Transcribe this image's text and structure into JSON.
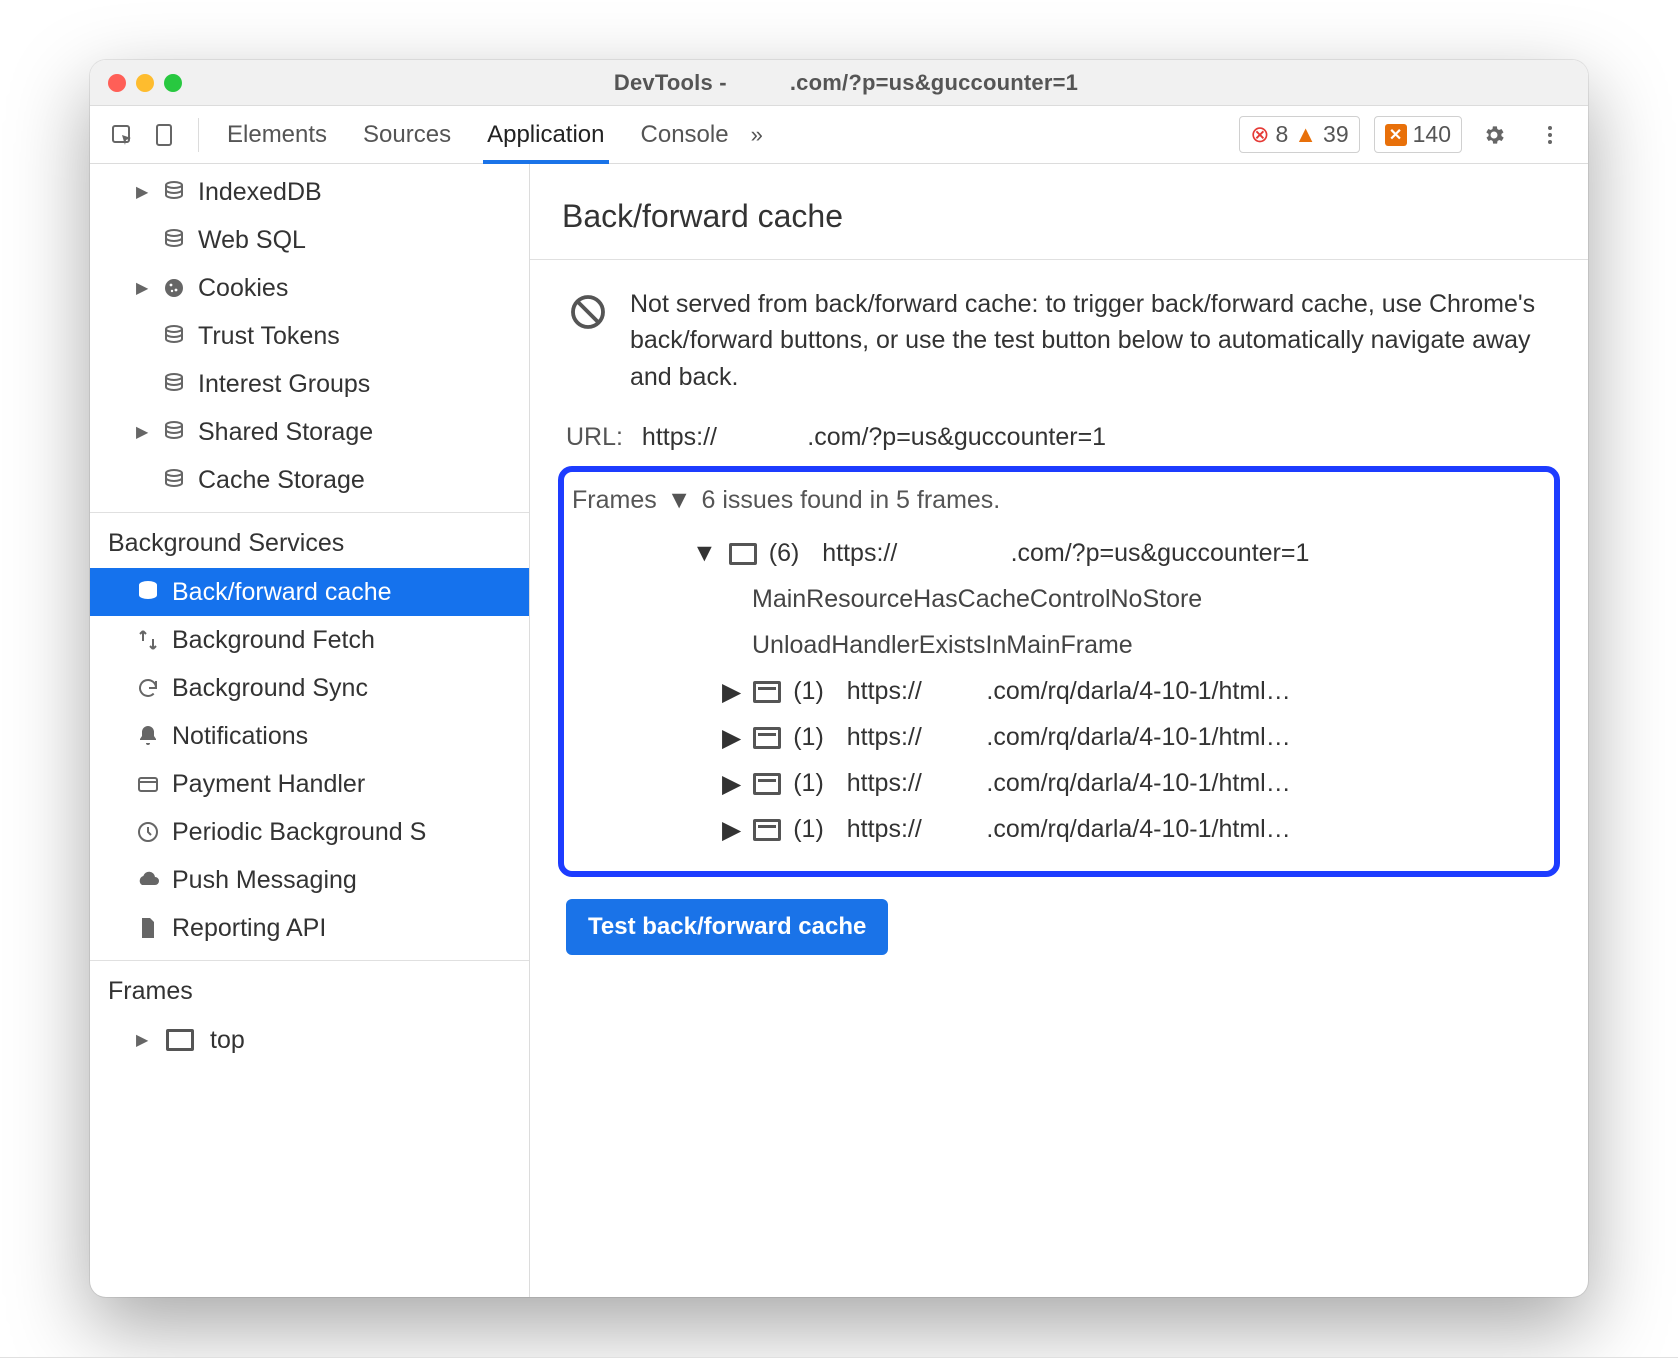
{
  "titlebar": {
    "prefix": "DevTools - ",
    "suffix": ".com/?p=us&guccounter=1"
  },
  "tabs": {
    "elements": "Elements",
    "sources": "Sources",
    "application": "Application",
    "console": "Console",
    "more": "»"
  },
  "counters": {
    "errors": "8",
    "warnings": "39",
    "issues": "140"
  },
  "sidebar": {
    "storage": [
      {
        "label": "IndexedDB",
        "caret": true,
        "icon": "db"
      },
      {
        "label": "Web SQL",
        "caret": false,
        "icon": "db"
      },
      {
        "label": "Cookies",
        "caret": true,
        "icon": "cookie"
      },
      {
        "label": "Trust Tokens",
        "caret": false,
        "icon": "db"
      },
      {
        "label": "Interest Groups",
        "caret": false,
        "icon": "db"
      },
      {
        "label": "Shared Storage",
        "caret": true,
        "icon": "db"
      },
      {
        "label": "Cache Storage",
        "caret": false,
        "icon": "db"
      }
    ],
    "bg_title": "Background Services",
    "bg": [
      {
        "label": "Back/forward cache",
        "icon": "db",
        "selected": true
      },
      {
        "label": "Background Fetch",
        "icon": "bfetch"
      },
      {
        "label": "Background Sync",
        "icon": "sync"
      },
      {
        "label": "Notifications",
        "icon": "bell"
      },
      {
        "label": "Payment Handler",
        "icon": "card"
      },
      {
        "label": "Periodic Background S",
        "icon": "clock"
      },
      {
        "label": "Push Messaging",
        "icon": "cloud"
      },
      {
        "label": "Reporting API",
        "icon": "doc"
      }
    ],
    "frames_title": "Frames",
    "frames": [
      {
        "label": "top",
        "caret": true
      }
    ]
  },
  "main": {
    "title": "Back/forward cache",
    "desc": "Not served from back/forward cache: to trigger back/forward cache, use Chrome's back/forward buttons, or use the test button below to automatically navigate away and back.",
    "url_label": "URL:",
    "url_prefix": "https://",
    "url_suffix": ".com/?p=us&guccounter=1",
    "frames_label": "Frames",
    "frames_summary": "6 issues found in 5 frames.",
    "root": {
      "count": "(6)",
      "prefix": "https://",
      "suffix": ".com/?p=us&guccounter=1"
    },
    "reasons": [
      "MainResourceHasCacheControlNoStore",
      "UnloadHandlerExistsInMainFrame"
    ],
    "children": [
      {
        "count": "(1)",
        "prefix": "https://",
        "suffix": ".com/rq/darla/4-10-1/html…"
      },
      {
        "count": "(1)",
        "prefix": "https://",
        "suffix": ".com/rq/darla/4-10-1/html…"
      },
      {
        "count": "(1)",
        "prefix": "https://",
        "suffix": ".com/rq/darla/4-10-1/html…"
      },
      {
        "count": "(1)",
        "prefix": "https://",
        "suffix": ".com/rq/darla/4-10-1/html…"
      }
    ],
    "test_button": "Test back/forward cache"
  }
}
